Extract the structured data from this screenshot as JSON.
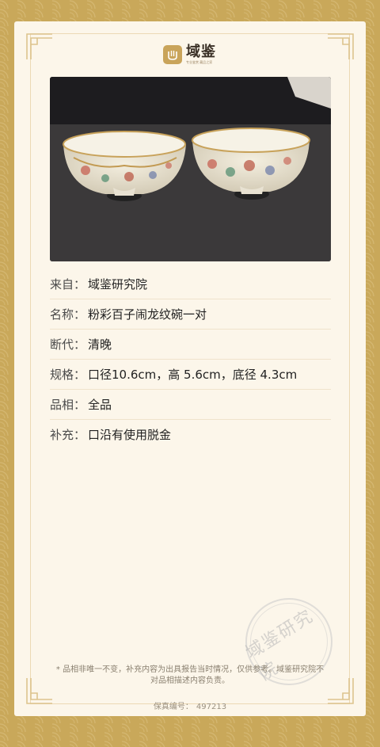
{
  "brand": {
    "name": "域鉴",
    "tagline": "专业鉴赏 藏品之家"
  },
  "rows": [
    {
      "label": "来自：",
      "value": "域鉴研究院"
    },
    {
      "label": "名称：",
      "value": "粉彩百子闹龙纹碗一对"
    },
    {
      "label": "断代：",
      "value": "清晚"
    },
    {
      "label": "规格：",
      "value": "口径10.6cm，高 5.6cm，底径 4.3cm"
    },
    {
      "label": "品相：",
      "value": "全品"
    },
    {
      "label": "补充：",
      "value": "口沿有使用脱金"
    }
  ],
  "seal": {
    "text": "域鉴研究院"
  },
  "disclaimer": "* 品相非唯一不变，补充内容为出具报告当时情况，仅供参考。域鉴研究院不对品相描述内容负责。",
  "serial": {
    "label": "保真编号：",
    "value": "497213"
  },
  "colors": {
    "background": "#c9a85a",
    "card": "#fcf6ea",
    "accent": "#c9a45a"
  },
  "icons": {
    "logo": "vessel-logo-icon",
    "corner": "fret-corner-ornament"
  }
}
